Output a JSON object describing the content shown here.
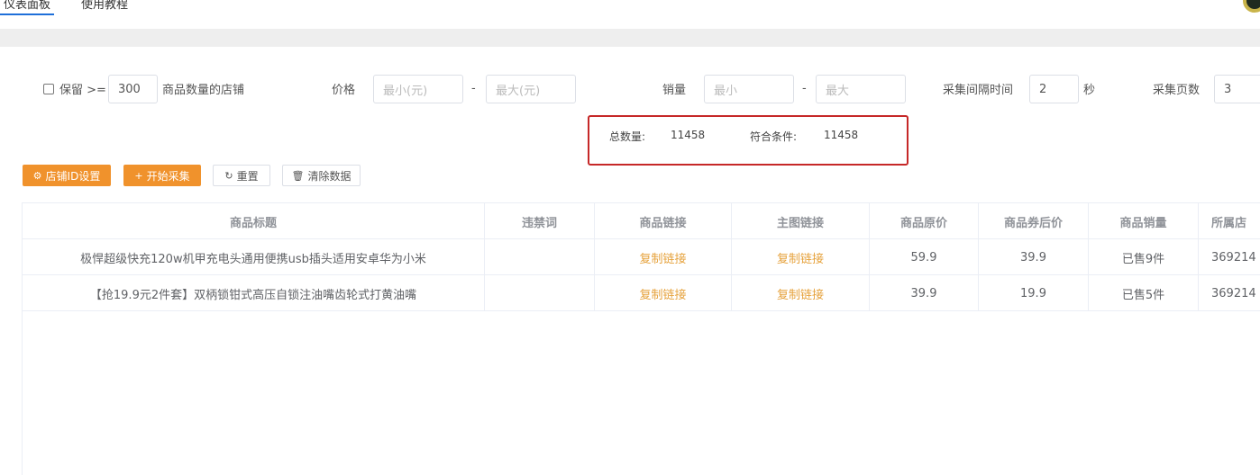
{
  "tabs": [
    {
      "label": "仪表面板"
    },
    {
      "label": "使用教程"
    }
  ],
  "filters": {
    "keep_label": "保留 >=",
    "keep_value": "300",
    "keep_suffix": "商品数量的店铺",
    "price_label": "价格",
    "price_min_placeholder": "最小(元)",
    "price_max_placeholder": "最大(元)",
    "dash": "-",
    "sales_label": "销量",
    "sales_min_placeholder": "最小",
    "sales_max_placeholder": "最大",
    "interval_label": "采集间隔时间",
    "interval_value": "2",
    "interval_unit": "秒",
    "pages_label": "采集页数",
    "pages_value": "3"
  },
  "totals": {
    "total_label": "总数量:",
    "total_value": "11458",
    "match_label": "符合条件:",
    "match_value": "11458"
  },
  "actions": {
    "shop_id": "店铺ID设置",
    "start": "开始采集",
    "reset": "重置",
    "clear": "清除数据"
  },
  "table": {
    "headers": [
      "商品标题",
      "违禁词",
      "商品链接",
      "主图链接",
      "商品原价",
      "商品券后价",
      "商品销量",
      "所属店"
    ],
    "rows": [
      {
        "title": "极悍超级快充120w机甲充电头通用便携usb插头适用安卓华为小米",
        "banned": "",
        "product_link": "复制链接",
        "image_link": "复制链接",
        "orig_price": "59.9",
        "coupon_price": "39.9",
        "sales": "已售9件",
        "shop": "369214"
      },
      {
        "title": "【抢19.9元2件套】双柄锁钳式高压自锁注油嘴齿轮式打黄油嘴",
        "banned": "",
        "product_link": "复制链接",
        "image_link": "复制链接",
        "orig_price": "39.9",
        "coupon_price": "19.9",
        "sales": "已售5件",
        "shop": "369214"
      }
    ]
  }
}
